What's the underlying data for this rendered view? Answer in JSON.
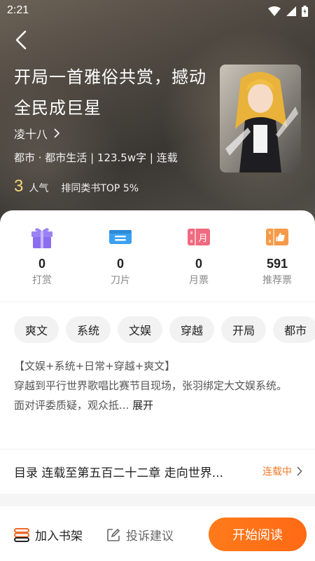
{
  "status_bar": {
    "time": "2:21"
  },
  "book": {
    "title": "开局一首雅俗共赏，撼动全民成巨星",
    "author": "凌十八",
    "meta": "都市 · 都市生活 | 123.5w字 | 连载",
    "popularity_value": "3",
    "popularity_label": "人气",
    "rank_text": "排同类书TOP 5%"
  },
  "stats": [
    {
      "icon": "gift-icon",
      "value": "0",
      "label": "打赏",
      "color": "#8b6ef0"
    },
    {
      "icon": "blade-icon",
      "value": "0",
      "label": "刀片",
      "color": "#3aa0f0"
    },
    {
      "icon": "monthly-ticket-icon",
      "value": "0",
      "label": "月票",
      "color": "#f06a80"
    },
    {
      "icon": "recommend-ticket-icon",
      "value": "591",
      "label": "推荐票",
      "color": "#f59a4a"
    }
  ],
  "tags": [
    "爽文",
    "系统",
    "文娱",
    "穿越",
    "开局",
    "都市"
  ],
  "description": {
    "line1": "【文娱+系统+日常+穿越+爽文】",
    "line2": "穿越到平行世界歌唱比赛节目现场，张羽绑定大文娱系统。",
    "line3": "面对评委质疑，观众抵...",
    "expand": "展开"
  },
  "toc": {
    "text": "目录 连载至第五百二十二章 走向世界...",
    "status": "连载中"
  },
  "bottom_bar": {
    "shelf_label": "加入书架",
    "report_label": "投诉建议",
    "read_label": "开始阅读"
  },
  "colors": {
    "accent": "#ff6a14",
    "status_orange": "#f07a28"
  }
}
